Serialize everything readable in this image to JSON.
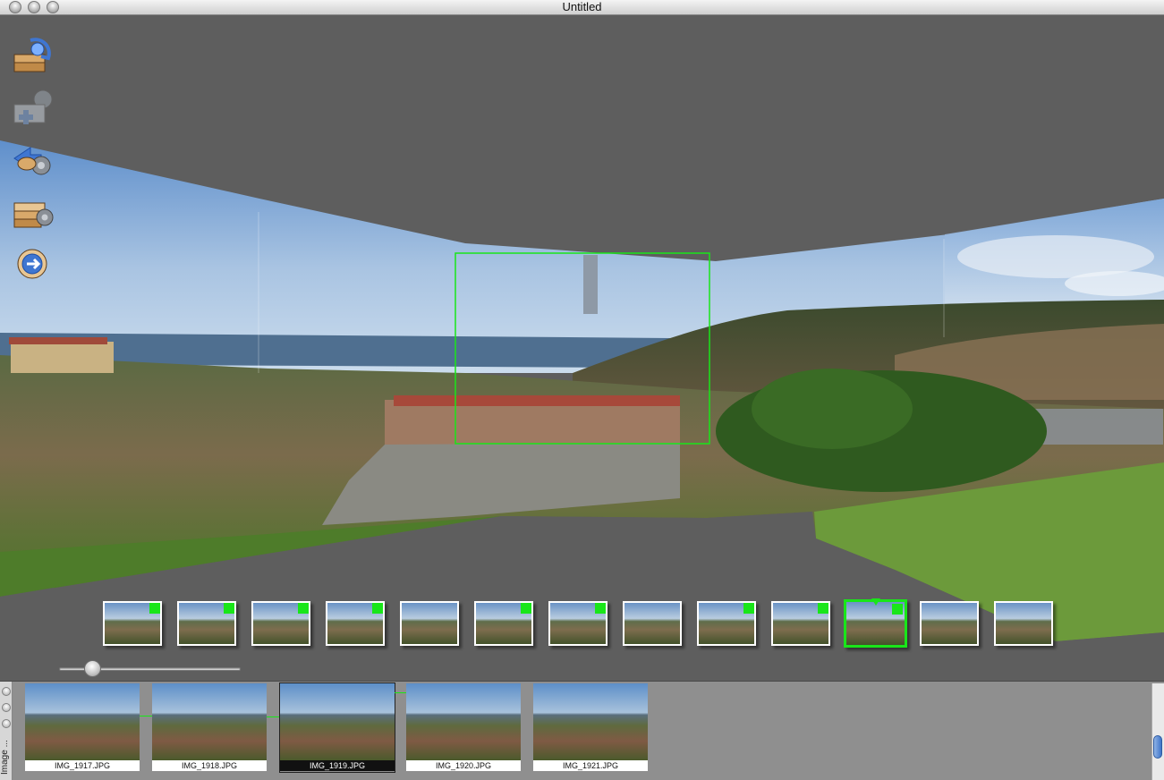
{
  "window": {
    "title": "Untitled"
  },
  "colors": {
    "accent_green": "#19e619",
    "canvas_bg": "#5e5e5e",
    "drawer_bg": "#8f8f8f"
  },
  "toolbar": {
    "tools": [
      {
        "icon": "panorama-open-icon"
      },
      {
        "icon": "add-images-icon"
      },
      {
        "icon": "project-settings-icon"
      },
      {
        "icon": "stitch-render-icon"
      },
      {
        "icon": "export-icon"
      }
    ]
  },
  "thumbnails": [
    {
      "flagged": true,
      "selected": false
    },
    {
      "flagged": true,
      "selected": false
    },
    {
      "flagged": true,
      "selected": false
    },
    {
      "flagged": true,
      "selected": false
    },
    {
      "flagged": false,
      "selected": false
    },
    {
      "flagged": true,
      "selected": false
    },
    {
      "flagged": true,
      "selected": false
    },
    {
      "flagged": false,
      "selected": false
    },
    {
      "flagged": true,
      "selected": false
    },
    {
      "flagged": true,
      "selected": false
    },
    {
      "flagged": true,
      "selected": true
    },
    {
      "flagged": false,
      "selected": false
    },
    {
      "flagged": false,
      "selected": false
    }
  ],
  "zoom_slider": {
    "value": 0.15
  },
  "drawer": {
    "label": "Image ...",
    "images": [
      {
        "name": "IMG_1917.JPG",
        "active": false
      },
      {
        "name": "IMG_1918.JPG",
        "active": false
      },
      {
        "name": "IMG_1919.JPG",
        "active": true
      },
      {
        "name": "IMG_1920.JPG",
        "active": false
      },
      {
        "name": "IMG_1921.JPG",
        "active": false
      }
    ]
  }
}
